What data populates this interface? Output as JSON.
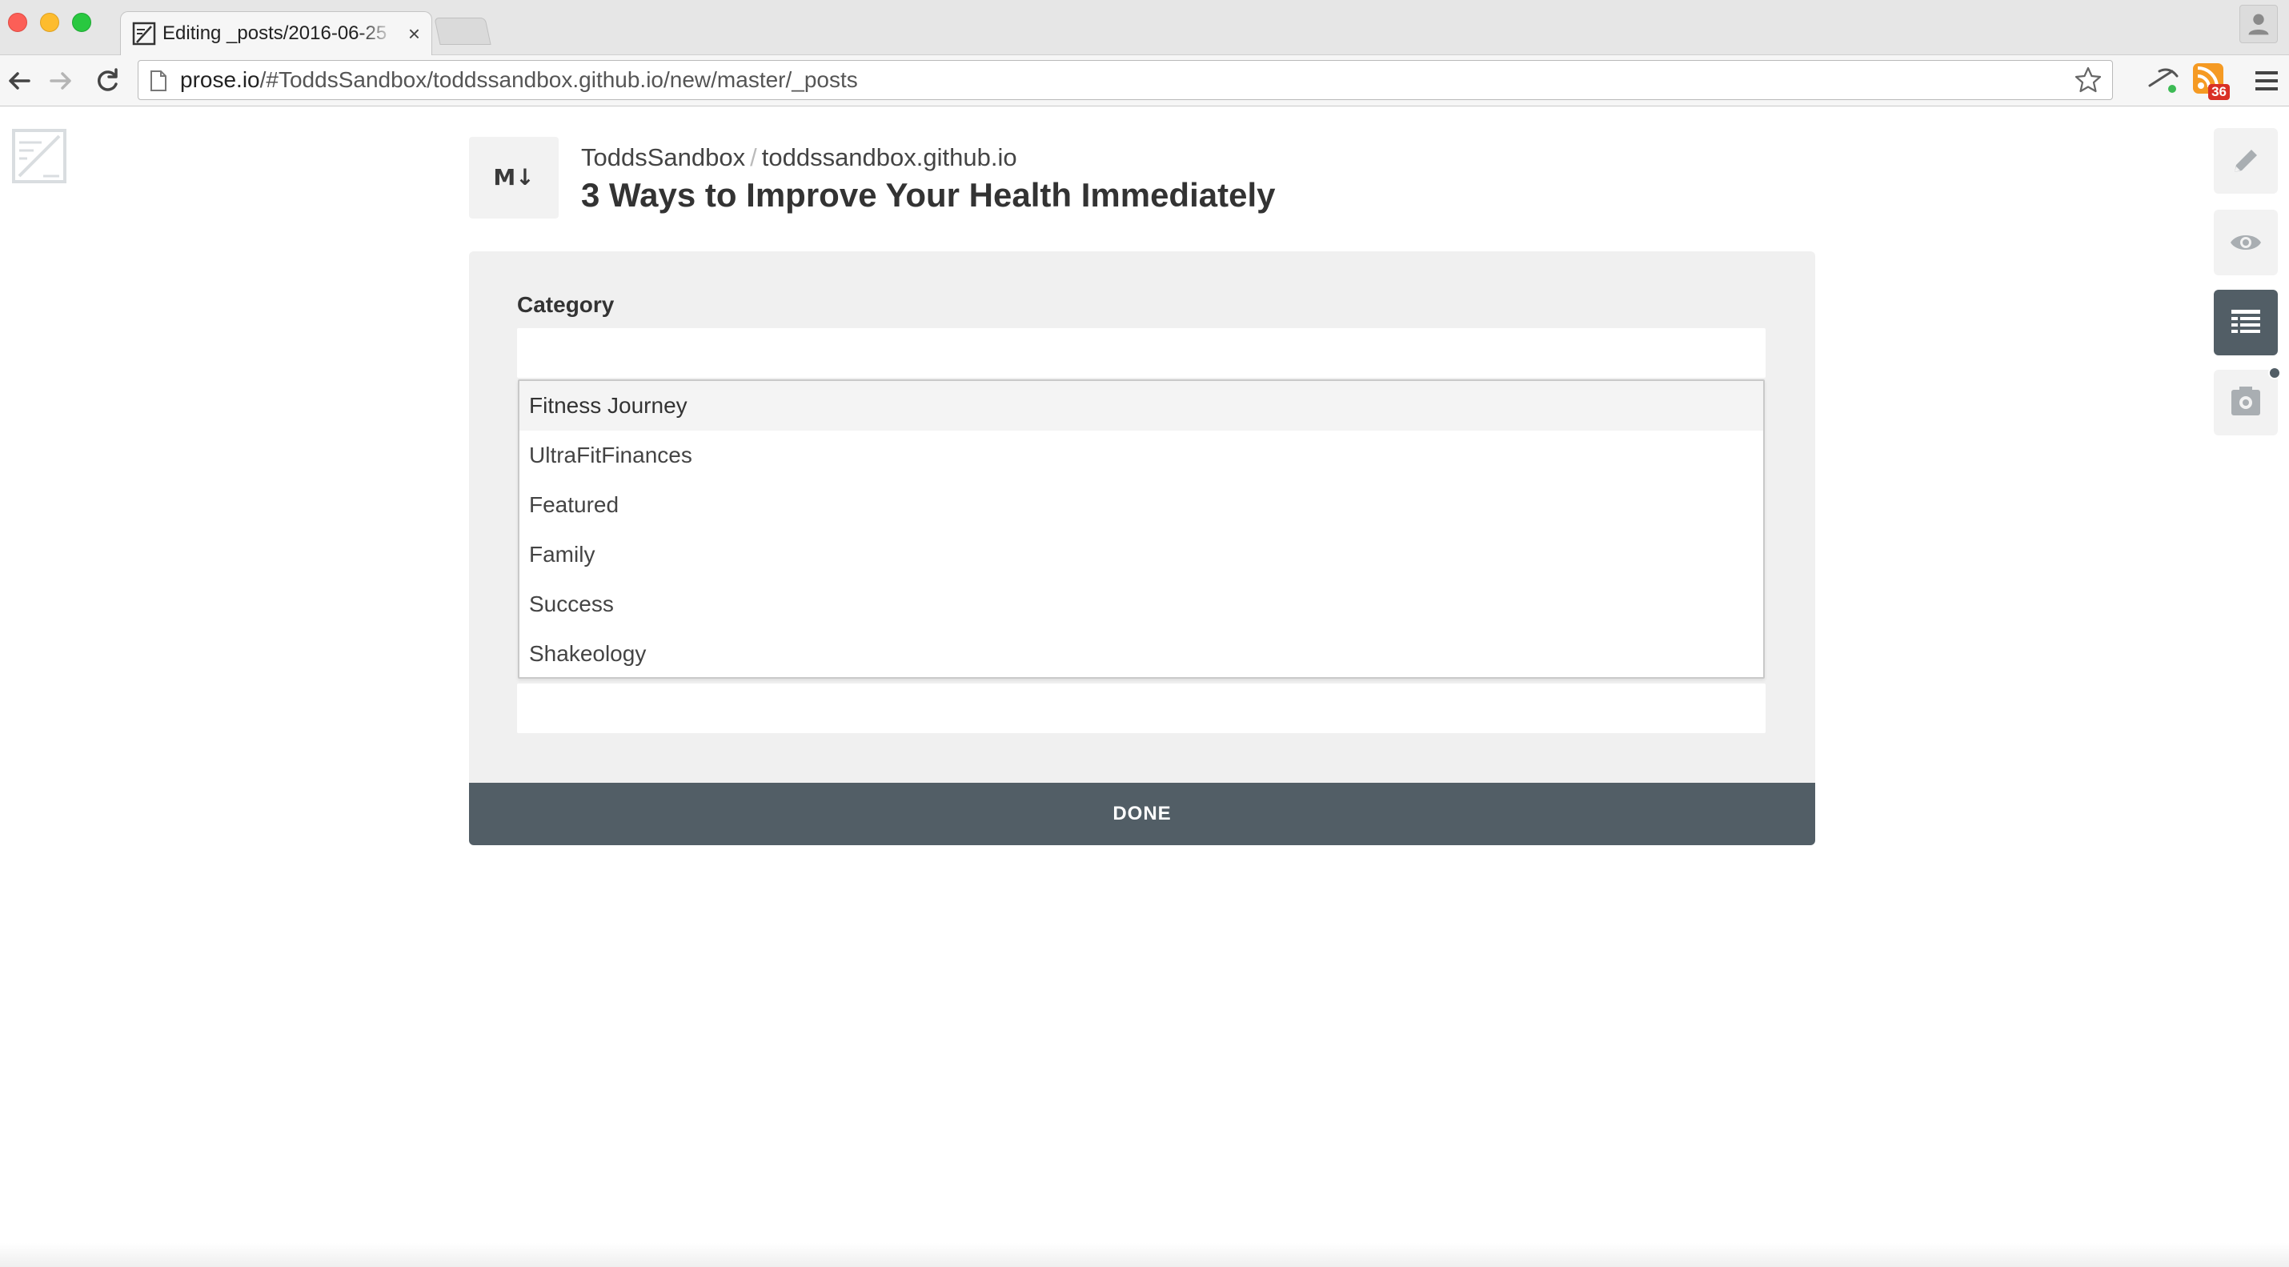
{
  "browser": {
    "tab_title": "Editing _posts/2016-06-25",
    "tab_close": "×",
    "url_host": "prose.io",
    "url_path": "/#ToddsSandbox/toddssandbox.github.io/new/master/_posts",
    "rss_count": "36"
  },
  "header": {
    "file_type": "M↓",
    "owner": "ToddsSandbox",
    "separator": "/",
    "repo": "toddssandbox.github.io",
    "title": "3 Ways to Improve Your Health Immediately"
  },
  "metadata": {
    "category_label": "Category",
    "category_value": "",
    "options": [
      "Fitness Journey",
      "UltraFitFinances",
      "Featured",
      "Family",
      "Success",
      "Shakeology"
    ],
    "highlighted_option": "Fitness Journey"
  },
  "actions": {
    "done_label": "DONE"
  },
  "side_nav": {
    "items": [
      "pencil-icon",
      "eye-icon",
      "list-icon",
      "camera-icon"
    ],
    "active": "list-icon"
  },
  "colors": {
    "accent": "#525e66",
    "panel_bg": "#f0f0f0"
  }
}
